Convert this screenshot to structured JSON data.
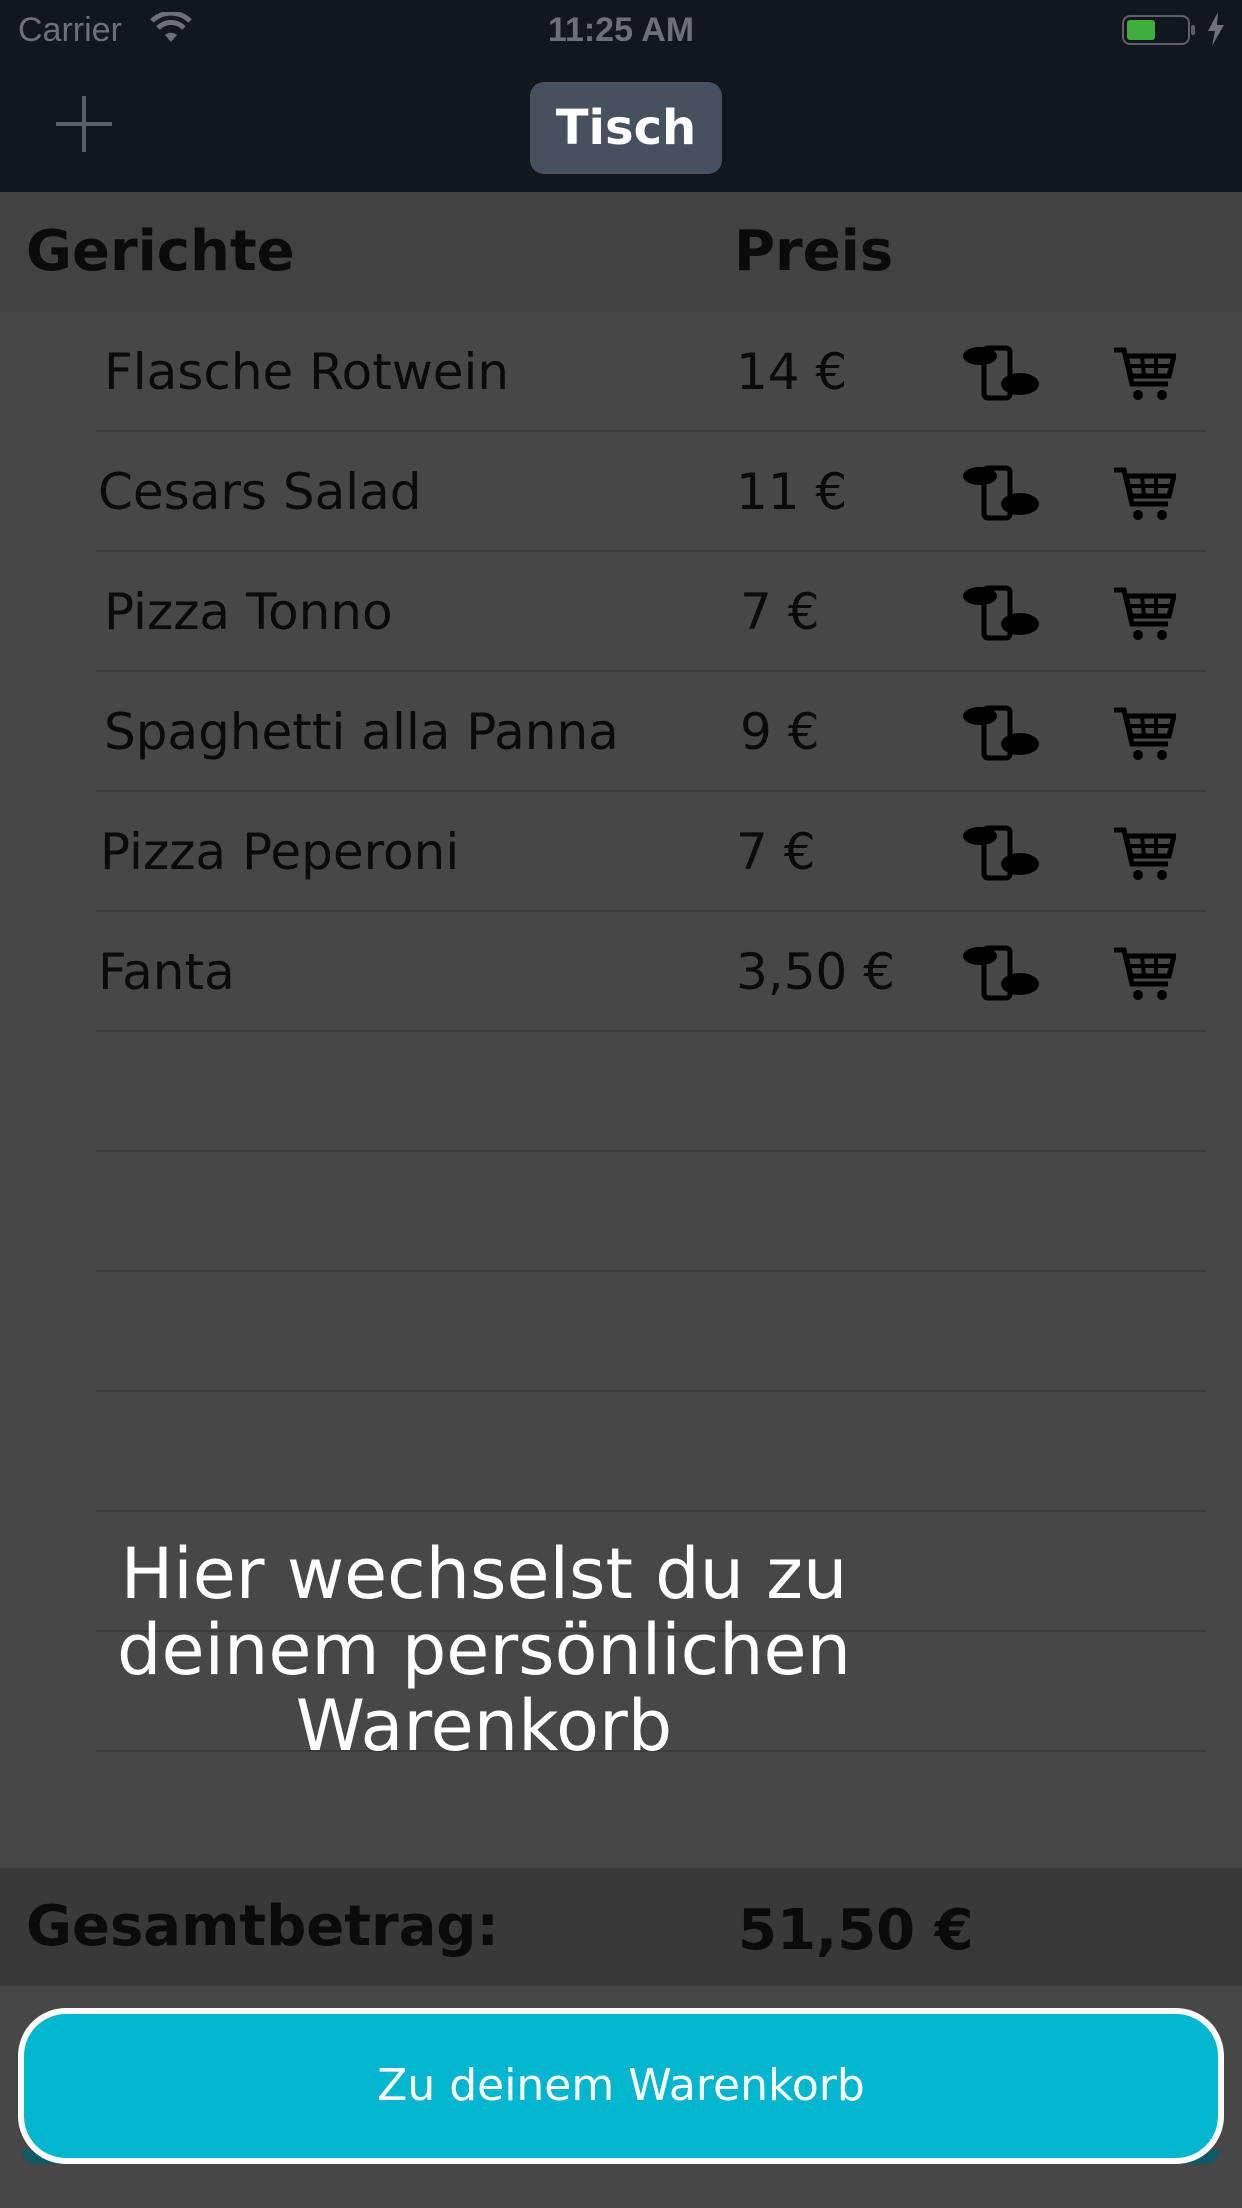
{
  "status_bar": {
    "carrier": "Carrier",
    "time": "11:25 AM",
    "battery_color": "#3fae3f"
  },
  "nav": {
    "title": "Tisch",
    "add_icon": "plus-icon"
  },
  "table_header": {
    "dishes": "Gerichte",
    "price": "Preis"
  },
  "items": [
    {
      "name": "Flasche Rotwein",
      "price": "14 €"
    },
    {
      "name": "Cesars Salad",
      "price": "11 €"
    },
    {
      "name": "Pizza Tonno",
      "price": "7 €"
    },
    {
      "name": "Spaghetti alla Panna",
      "price": "9 €"
    },
    {
      "name": "Pizza Peperoni",
      "price": "7 €"
    },
    {
      "name": "Fanta",
      "price": "3,50 €"
    }
  ],
  "row_icons": {
    "share": "hand-share-icon",
    "cart": "shopping-cart-icon"
  },
  "hint": "Hier wechselst du zu\ndeinem persönlichen\nWarenkorb",
  "total": {
    "label": "Gesamtbetrag:",
    "value": "51,50 €"
  },
  "cart_button": {
    "label": "Zu deinem Warenkorb",
    "color": "#02b6d0"
  }
}
